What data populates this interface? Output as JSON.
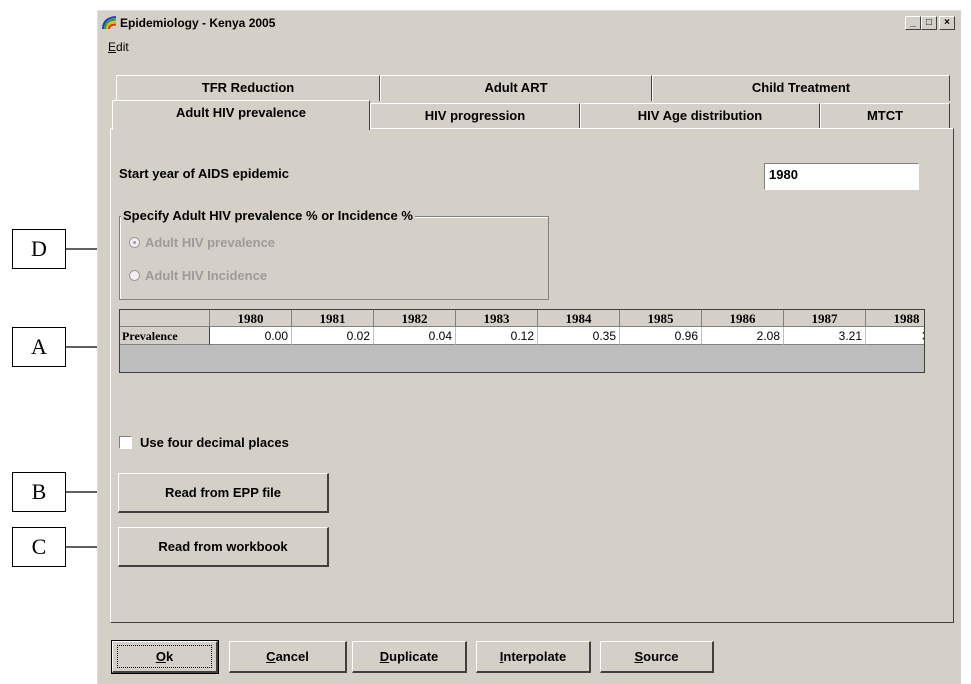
{
  "window": {
    "title": "Epidemiology - Kenya 2005",
    "controls": {
      "minimize": "_",
      "maximize": "□",
      "close": "×"
    }
  },
  "menu": {
    "items": [
      {
        "label": "Edit",
        "accel": "E",
        "rest": "dit"
      }
    ]
  },
  "tabs": {
    "row1": [
      {
        "label": "TFR Reduction"
      },
      {
        "label": "Adult ART"
      },
      {
        "label": "Child Treatment"
      }
    ],
    "row2": [
      {
        "label": "Adult HIV prevalence",
        "selected": true
      },
      {
        "label": "HIV progression"
      },
      {
        "label": "HIV Age distribution"
      },
      {
        "label": "MTCT"
      }
    ]
  },
  "form": {
    "start_year_label": "Start year of AIDS epidemic",
    "start_year_value": "1980",
    "group_title": "Specify Adult HIV prevalence % or Incidence %",
    "radio_prevalence": "Adult HIV prevalence",
    "radio_incidence": "Adult HIV Incidence",
    "selected_option": "Adult HIV prevalence",
    "checkbox_label": "Use four decimal places",
    "checkbox_checked": false,
    "read_epp_button": "Read from EPP file",
    "read_workbook_button": "Read from workbook"
  },
  "table": {
    "row_header": "Prevalence",
    "years": [
      "1980",
      "1981",
      "1982",
      "1983",
      "1984",
      "1985",
      "1986",
      "1987",
      "1988"
    ],
    "values": [
      "0.00",
      "0.02",
      "0.04",
      "0.12",
      "0.35",
      "0.96",
      "2.08",
      "3.21",
      "3"
    ]
  },
  "buttons": {
    "ok": {
      "accel": "O",
      "rest": "k"
    },
    "cancel": {
      "accel": "C",
      "rest": "ancel"
    },
    "duplicate": {
      "accel": "D",
      "rest": "uplicate"
    },
    "interpolate": {
      "accel": "I",
      "rest": "nterpolate"
    },
    "source": {
      "accel": "S",
      "rest": "ource"
    }
  },
  "annotations": {
    "a": "A",
    "b": "B",
    "c": "C",
    "d": "D"
  },
  "colors": {
    "window_face": "#d4d0c8",
    "disabled_text": "#9b9b9b"
  }
}
